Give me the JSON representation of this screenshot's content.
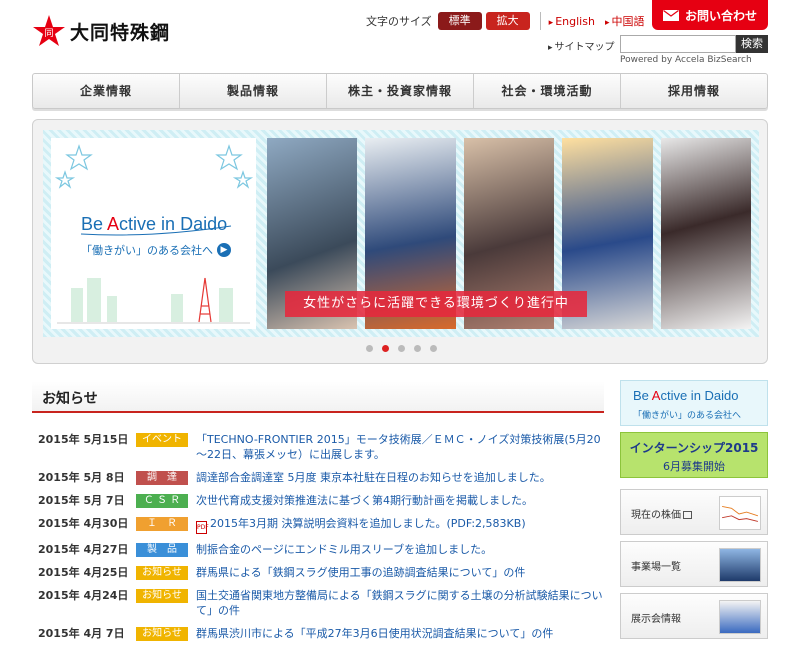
{
  "header": {
    "company": "大同特殊鋼",
    "logo_char": "同",
    "font_size_label": "文字のサイズ",
    "font_standard": "標準",
    "font_large": "拡大",
    "lang_en": "English",
    "lang_cn": "中国語",
    "contact": "お問い合わせ",
    "sitemap": "サイトマップ",
    "search_button": "検索",
    "search_value": "",
    "powered": "Powered by Accela BizSearch"
  },
  "nav": [
    "企業情報",
    "製品情報",
    "株主・投資家情報",
    "社会・環境活動",
    "採用情報"
  ],
  "hero": {
    "promo_title_pre": "Be ",
    "promo_title_a": "A",
    "promo_title_post": "ctive in Daido",
    "promo_sub": "「働きがい」のある会社へ",
    "caption": "女性がさらに活躍できる環境づくり進行中",
    "slide_count": 5,
    "active_slide": 2
  },
  "news": {
    "title": "お知らせ",
    "items": [
      {
        "date": "2015年 5月15日",
        "tag": "イベント",
        "tag_color": "#f0b400",
        "text": "「TECHNO-FRONTIER 2015」モータ技術展／ＥＭＣ・ノイズ対策技術展(5月20～22日、幕張メッセ）に出展します。"
      },
      {
        "date": "2015年 5月 8日",
        "tag": "調　達",
        "tag_color": "#c0504d",
        "text": "調達部合金調達室 5月度 東京本社駐在日程のお知らせを追加しました。"
      },
      {
        "date": "2015年 5月 7日",
        "tag": "Ｃ Ｓ Ｒ",
        "tag_color": "#4caf50",
        "text": "次世代育成支援対策推進法に基づく第4期行動計画を掲載しました。"
      },
      {
        "date": "2015年 4月30日",
        "tag": "Ｉ　Ｒ",
        "tag_color": "#f0a030",
        "text": "2015年3月期 決算説明会資料を追加しました。(PDF:2,583KB)",
        "pdf": true
      },
      {
        "date": "2015年 4月27日",
        "tag": "製　品",
        "tag_color": "#3a8fd8",
        "text": "制振合金のページにエンドミル用スリーブを追加しました。"
      },
      {
        "date": "2015年 4月25日",
        "tag": "お知らせ",
        "tag_color": "#f0b400",
        "text": "群馬県による「鉄鋼スラグ使用工事の追跡調査結果について」の件"
      },
      {
        "date": "2015年 4月24日",
        "tag": "お知らせ",
        "tag_color": "#f0b400",
        "text": "国土交通省関東地方整備局による「鉄鋼スラグに関する土壌の分析試験結果について」の件"
      },
      {
        "date": "2015年 4月 7日",
        "tag": "お知らせ",
        "tag_color": "#f0b400",
        "text": "群馬県渋川市による「平成27年3月6日使用状況調査結果について」の件"
      }
    ]
  },
  "sidebar": {
    "banner1_pre": "Be ",
    "banner1_a": "A",
    "banner1_post": "ctive in Daido",
    "banner1_sub": "「働きがい」のある会社へ",
    "banner2_title": "インターンシップ2015",
    "banner2_sub": "6月募集開始",
    "stock": "現在の株価",
    "offices": "事業場一覧",
    "exhibitions": "展示会情報"
  }
}
